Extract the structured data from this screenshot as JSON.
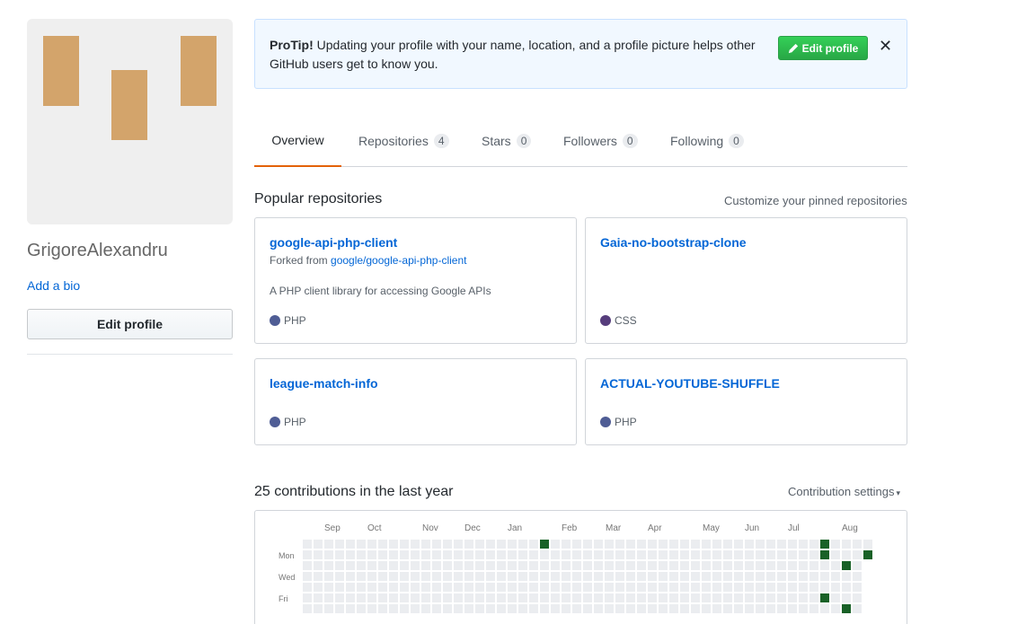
{
  "profile": {
    "username": "GrigoreAlexandru",
    "add_bio": "Add a bio",
    "edit_profile": "Edit profile",
    "avatar_color": "#d3a46b"
  },
  "protip": {
    "label": "ProTip!",
    "text": " Updating your profile with your name, location, and a profile picture helps other GitHub users get to know you.",
    "button": "Edit profile",
    "close": "✕"
  },
  "tabs": [
    {
      "label": "Overview",
      "count": null,
      "active": true
    },
    {
      "label": "Repositories",
      "count": "4"
    },
    {
      "label": "Stars",
      "count": "0"
    },
    {
      "label": "Followers",
      "count": "0"
    },
    {
      "label": "Following",
      "count": "0"
    }
  ],
  "popular": {
    "title": "Popular repositories",
    "customize": "Customize your pinned repositories",
    "repos": [
      {
        "name": "google-api-php-client",
        "fork_prefix": "Forked from ",
        "fork_source": "google/google-api-php-client",
        "description": "A PHP client library for accessing Google APIs",
        "language": "PHP",
        "lang_color": "#4F5D95"
      },
      {
        "name": "Gaia-no-bootstrap-clone",
        "language": "CSS",
        "lang_color": "#563d7c"
      },
      {
        "name": "league-match-info",
        "language": "PHP",
        "lang_color": "#4F5D95"
      },
      {
        "name": "ACTUAL-YOUTUBE-SHUFFLE",
        "language": "PHP",
        "lang_color": "#4F5D95"
      }
    ]
  },
  "contributions": {
    "title": "25 contributions in the last year",
    "settings": "Contribution settings",
    "months": [
      "Sep",
      "Oct",
      "Nov",
      "Dec",
      "Jan",
      "Feb",
      "Mar",
      "Apr",
      "May",
      "Jun",
      "Jul",
      "Aug"
    ],
    "days": [
      "Mon",
      "Wed",
      "Fri"
    ],
    "empty_color": "#ebedf0",
    "active_color": "#196127",
    "active_cells": [
      [
        22,
        0
      ],
      [
        48,
        0
      ],
      [
        48,
        1
      ],
      [
        50,
        2
      ],
      [
        48,
        5
      ],
      [
        50,
        6
      ],
      [
        52,
        1
      ]
    ]
  }
}
